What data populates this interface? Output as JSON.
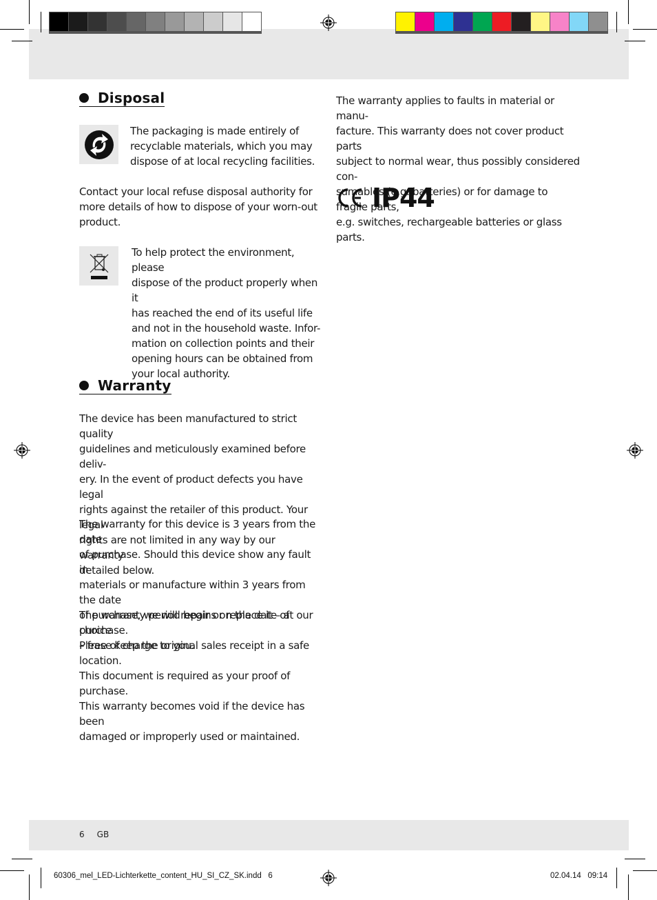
{
  "print_marks": {
    "gray_swatches": [
      "#000000",
      "#1b1b1b",
      "#333333",
      "#4d4d4d",
      "#666666",
      "#808080",
      "#999999",
      "#b3b3b3",
      "#cccccc",
      "#e6e6e6",
      "#ffffff"
    ],
    "color_swatches": [
      "#fff200",
      "#ec008c",
      "#00aeef",
      "#2e3192",
      "#00a651",
      "#ed1c24",
      "#231f20",
      "#fff685",
      "#f783c8",
      "#82d7f7",
      "#8f8f8f"
    ]
  },
  "disposal": {
    "heading": "Disposal",
    "recycle_icon": "recycle-green-dot-icon",
    "packaging_text": "The packaging is made entirely of\nrecyclable materials, which you may\ndispose of at local recycling facilities.",
    "contact_text": "Contact your local refuse disposal authority for\nmore details of how to dispose of your worn-out\nproduct.",
    "weee_icon": "crossed-bin-icon",
    "environment_text": "To help protect the environment, please\ndispose of the product properly when it\nhas reached the end of its useful life\nand not in the household waste. Infor-\nmation on collection points and their\nopening hours can be obtained from\nyour local authority."
  },
  "warranty": {
    "heading": "Warranty",
    "paragraphs": [
      "The device has been manufactured to strict quality\nguidelines and meticulously examined before deliv-\nery. In the event of product defects you have legal\nrights against the retailer of this product. Your legal\nrights are not limited in any way by our warranty\ndetailed below.",
      "The warranty for this device is 3 years from the date\nof purchase. Should this device show any fault in\nmaterials or manufacture within 3 years from the date\nof purchase, we will repair or replace it – at our choice\n– free of charge to you.",
      "The warranty period begins on the date of purchase.\nPlease keep the original sales receipt in a safe location.\nThis document is required as your proof of purchase.\nThis warranty becomes void if the device has been\ndamaged or improperly used or maintained."
    ],
    "right_paragraph": "The warranty applies to faults in material or manu-\nfacture. This warranty does not cover product parts\nsubject to normal wear, thus possibly considered con-\nsumables (e.g. batteries) or for damage to fragile parts,\ne.g. switches, rechargeable batteries or glass parts."
  },
  "certification": {
    "ce_mark": "CE",
    "ip_rating": "IP44"
  },
  "footer": {
    "page_number": "6",
    "language": "GB",
    "file_name": "60306_mel_LED-Lichterkette_content_HU_SI_CZ_SK.indd   6",
    "date": "02.04.14",
    "time": "09:14"
  }
}
